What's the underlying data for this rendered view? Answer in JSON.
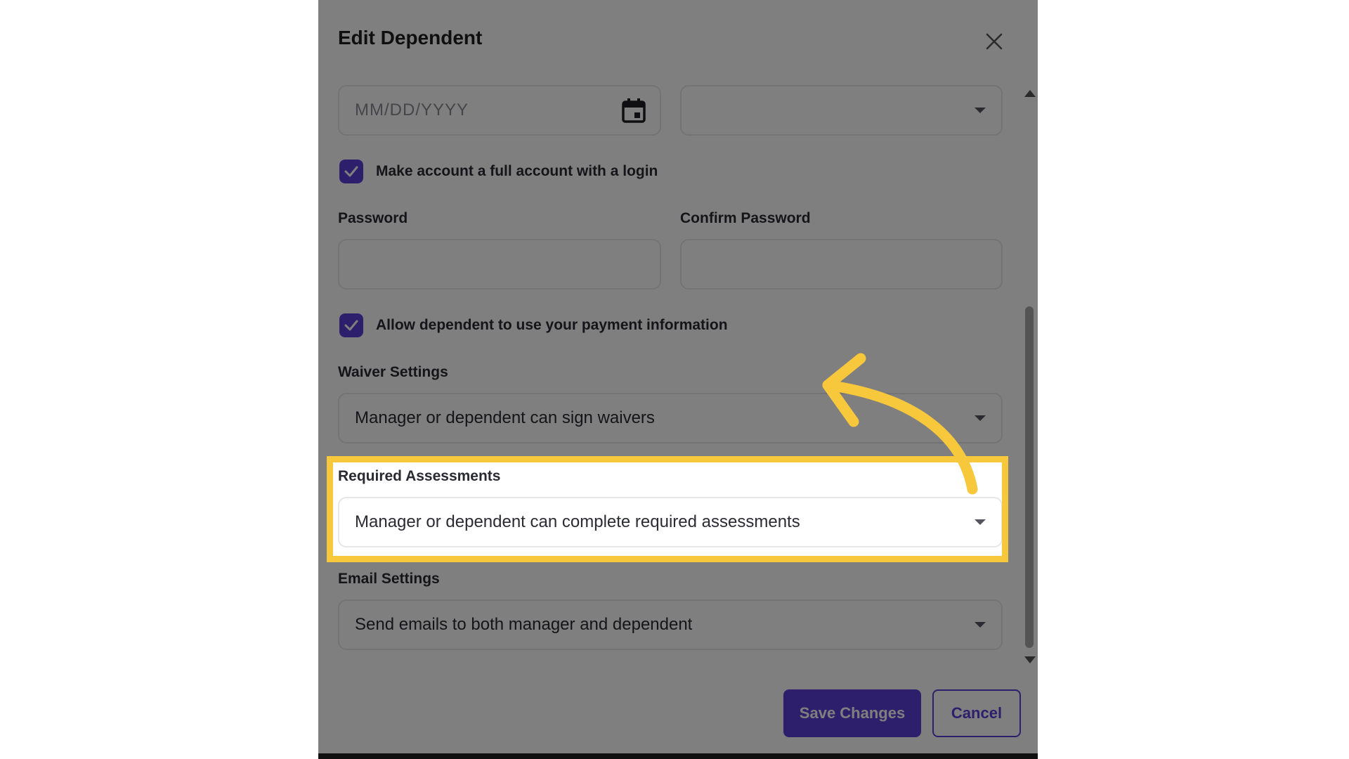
{
  "dialog": {
    "title": "Edit Dependent",
    "close_icon": "close-icon"
  },
  "date_field": {
    "placeholder": "MM/DD/YYYY",
    "icon": "calendar-icon"
  },
  "second_select": {
    "value": ""
  },
  "full_account_checkbox": {
    "checked": true,
    "label": "Make account a full account with a login"
  },
  "password": {
    "label": "Password",
    "value": ""
  },
  "confirm_password": {
    "label": "Confirm Password",
    "value": ""
  },
  "payment_checkbox": {
    "checked": true,
    "label": "Allow dependent to use your payment information"
  },
  "waiver_settings": {
    "label": "Waiver Settings",
    "value": "Manager or dependent can sign waivers"
  },
  "required_assessments": {
    "label": "Required Assessments",
    "value": "Manager or dependent can complete required assessments"
  },
  "email_settings": {
    "label": "Email Settings",
    "value": "Send emails to both manager and dependent"
  },
  "buttons": {
    "save": "Save Changes",
    "cancel": "Cancel"
  },
  "colors": {
    "accent": "#5b3fd6",
    "highlight": "#f7c73c",
    "overlay": "rgba(0,0,0,0.5)"
  }
}
